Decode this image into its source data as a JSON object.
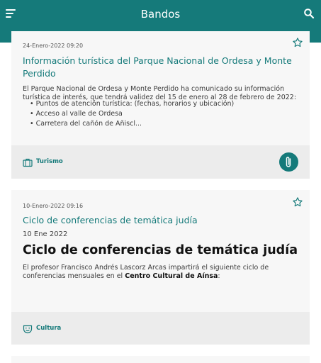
{
  "appbar": {
    "title": "Bandos",
    "menu_icon": "hamburger-menu-icon",
    "search_icon": "search-icon"
  },
  "colors": {
    "primary": "#157a7a",
    "card_bg": "#f7f7f7",
    "footer_bg": "#ececec"
  },
  "cards": [
    {
      "date": "24-Enero-2022 09:20",
      "title_line1": "Información turística del Parque Nacional de Ordesa y Monte",
      "title_line2": "Perdido",
      "body_line1": "El Parque Nacional de Ordesa y Monte Perdido ha comunicado su información",
      "body_line2": "turística de interés, que tendrá validez del 15 de enero al 28 de febrero de 2022:",
      "bullets": [
        "Puntos de atención turística: (fechas, horarios y ubicación)",
        "Acceso al valle de Ordesa",
        "Carretera del cañón de Añiscl..."
      ],
      "category": "Turismo",
      "category_icon": "suitcase-icon",
      "attachment_icon": "paperclip-icon"
    },
    {
      "date": "10-Enero-2022 09:16",
      "title": "Ciclo de conferencias de temática judía",
      "sub_date": "10 Ene 2022",
      "heading": "Ciclo de conferencias de temática judía",
      "body_line1": "El profesor Francisco Andrés Lascorz Arcas impartirá el siguiente ciclo de",
      "body_line2_a": "conferencias mensuales en el ",
      "body_line2_b": "Centro Cultural de Aínsa",
      "body_line2_c": ":",
      "category": "Cultura",
      "category_icon": "theater-masks-icon"
    }
  ]
}
